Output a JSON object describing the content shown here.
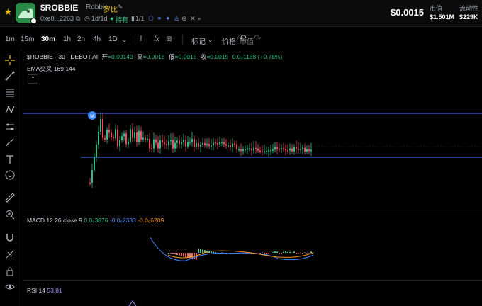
{
  "header": {
    "symbol": "$ROBBIE",
    "name": "Robbie",
    "cn_name": "罗比",
    "edit_icon": "pencil-icon",
    "address": "0xe0...2263",
    "age": "1d/1d",
    "holding_label": "持有",
    "ratio": "1/1",
    "price": "$0.0015",
    "market_cap_label": "市值",
    "market_cap": "$1.501M",
    "liquidity_label": "流动性",
    "liquidity": "$229K"
  },
  "toolbar": {
    "timeframes": [
      "1m",
      "15m",
      "30m",
      "1h",
      "2h",
      "4h",
      "1D"
    ],
    "active_timeframe": "30m",
    "indicator_label": "标记",
    "price_label": "价格",
    "mcap_label": "市值",
    "fx_label": "fx"
  },
  "legend": {
    "title": "$ROBBIE · 30 · DEBOT.AI",
    "open_label": "开",
    "open": "=0.00149",
    "high_label": "高",
    "high": "=0.0015",
    "low_label": "低",
    "low": "=0.0015",
    "close_label": "收",
    "close": "=0.0015",
    "change": "0.0₄1158 (+0.78%)",
    "ema_label": "EMA交叉 169 144",
    "collapse_icon": "chevron-up-icon"
  },
  "macd": {
    "label": "MACD 12 26 close 9",
    "v1": "0.0₆3876",
    "v2": "-0.0₆2333",
    "v3": "-0.0₆6209"
  },
  "rsi": {
    "label": "RSI 14",
    "value": "53.81"
  },
  "marker": "M",
  "colors": {
    "up": "#2ebd85",
    "down": "#f6465d",
    "line": "#3b5bdb",
    "accent": "#f5c518"
  }
}
